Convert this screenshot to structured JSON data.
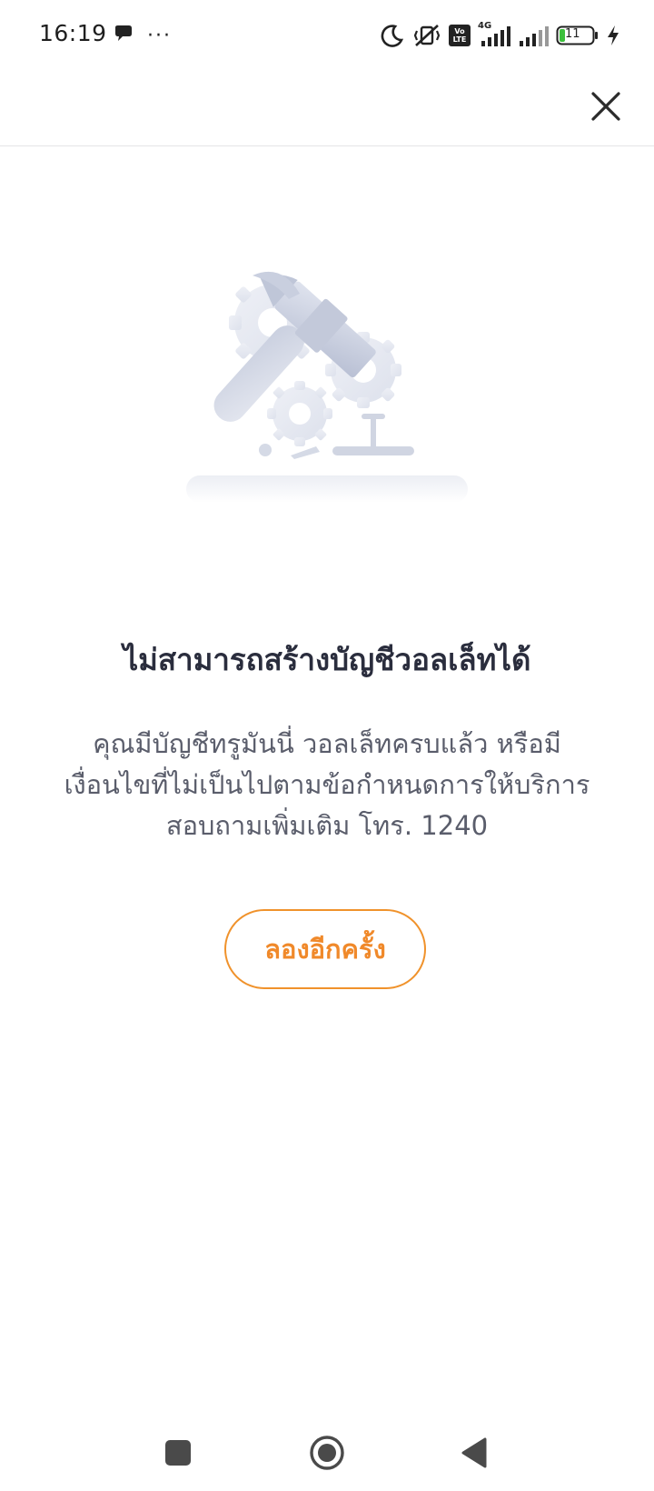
{
  "status_bar": {
    "time": "16:19",
    "more_indicator": "···",
    "network_type": "4G",
    "volte_label": "Vo LTE",
    "battery_level": "11",
    "icons": [
      "chat-bubble-icon",
      "moon-icon",
      "vibrate-off-icon",
      "volte-icon",
      "signal-4g-icon",
      "signal-icon",
      "battery-icon",
      "charging-bolt-icon"
    ]
  },
  "header": {
    "close_icon": "close-icon"
  },
  "illustration": {
    "name": "maintenance-tools-illustration"
  },
  "error": {
    "title": "ไม่สามารถสร้างบัญชีวอลเล็ทได้",
    "message_lines": [
      "คุณมีบัญชีทรูมันนี่ วอลเล็ทครบแล้ว หรือมี",
      "เงื่อนไขที่ไม่เป็นไปตามข้อกำหนดการให้บริการ",
      "สอบถามเพิ่มเติม โทร. 1240"
    ]
  },
  "retry_button": {
    "label": "ลองอีกครั้ง"
  },
  "nav_bar": {
    "icons": [
      "recent-apps-icon",
      "home-icon",
      "back-icon"
    ]
  },
  "colors": {
    "accent": "#f0922b",
    "title": "#2a2d3d",
    "body_text": "#5a5d6b",
    "divider": "#e4e4e6",
    "illustration": "#cfd4e3"
  }
}
